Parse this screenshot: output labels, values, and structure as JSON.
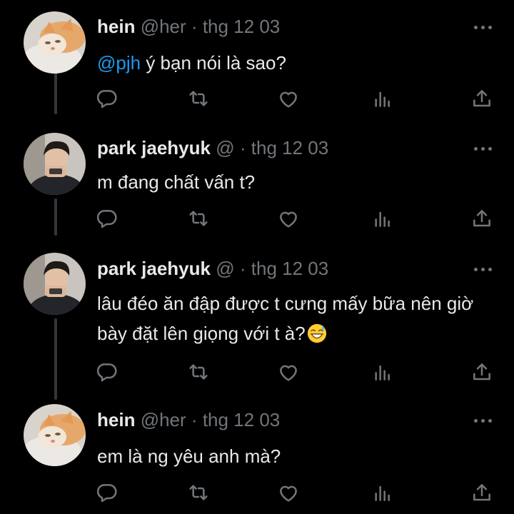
{
  "tweets": [
    {
      "name": "hein",
      "handle": "@her",
      "separator": "·",
      "date": "thg 12 03",
      "mention": "@pjh",
      "text": " ý bạn nói là sao?",
      "avatar": "cat-avatar"
    },
    {
      "name": "park jaehyuk",
      "handle": "@",
      "separator": "·",
      "date": "thg 12 03",
      "text": "m đang chất vấn t?",
      "avatar": "boy-avatar"
    },
    {
      "name": "park jaehyuk",
      "handle": "@",
      "separator": "·",
      "date": "thg 12 03",
      "text_line1": "lâu đéo ăn đập được t cưng mấy bữa nên giờ",
      "text_line2": "bày đặt lên giọng với t à?",
      "emoji": "grinning-sweat-emoji",
      "avatar": "boy-avatar"
    },
    {
      "name": "hein",
      "handle": "@her",
      "separator": "·",
      "date": "thg 12 03",
      "text": "em là ng yêu anh mà?",
      "avatar": "cat-avatar"
    }
  ],
  "icons": {
    "reply": "comment-icon",
    "retweet": "retweet-icon",
    "like": "heart-icon",
    "views": "views-icon",
    "share": "share-icon",
    "more": "more-dots-icon"
  },
  "colors": {
    "background": "#000000",
    "text": "#e7e9ea",
    "secondary": "#71767b",
    "link": "#1d9bf0",
    "thread_line": "#333639"
  }
}
